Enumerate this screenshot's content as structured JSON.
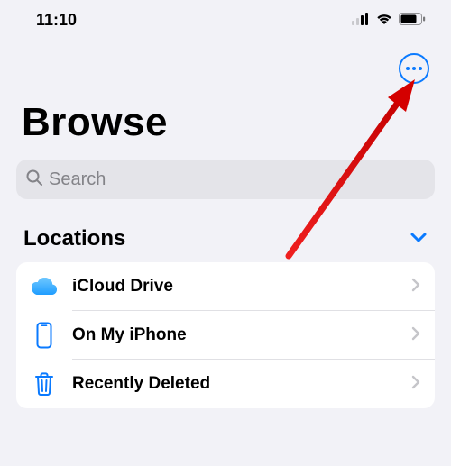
{
  "status": {
    "time": "11:10"
  },
  "title": "Browse",
  "search": {
    "placeholder": "Search"
  },
  "section": {
    "title": "Locations"
  },
  "rows": {
    "0": {
      "label": "iCloud Drive"
    },
    "1": {
      "label": "On My iPhone"
    },
    "2": {
      "label": "Recently Deleted"
    }
  },
  "colors": {
    "accent": "#0a7aff"
  }
}
